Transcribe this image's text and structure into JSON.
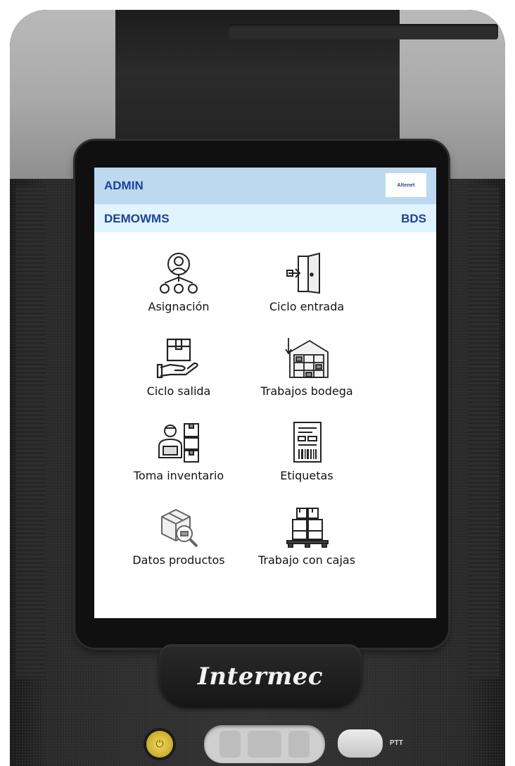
{
  "header": {
    "user": "ADMIN",
    "logo_text": "Altenet",
    "warehouse": "DEMOWMS",
    "company": "BDS"
  },
  "menu": [
    {
      "label": "Asignación",
      "icon": "people-assignment-icon"
    },
    {
      "label": "Ciclo entrada",
      "icon": "entry-door-icon"
    },
    {
      "label": "Ciclo salida",
      "icon": "package-hand-icon"
    },
    {
      "label": "Trabajos bodega",
      "icon": "warehouse-icon"
    },
    {
      "label": "Toma inventario",
      "icon": "inventory-worker-icon"
    },
    {
      "label": "Etiquetas",
      "icon": "barcode-label-icon"
    },
    {
      "label": "Datos productos",
      "icon": "box-search-icon"
    },
    {
      "label": "Trabajo con cajas",
      "icon": "boxes-pallet-icon"
    }
  ],
  "device": {
    "brand": "Intermec",
    "ptt_label": "PTT"
  }
}
